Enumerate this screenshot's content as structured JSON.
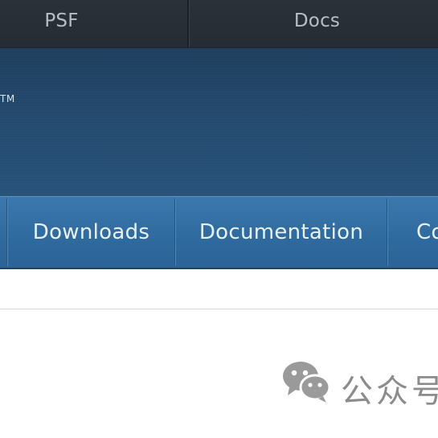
{
  "top_nav": {
    "items": [
      {
        "label": "PSF"
      },
      {
        "label": "Docs"
      }
    ]
  },
  "header": {
    "trademark": "TM"
  },
  "main_nav": {
    "items": [
      {
        "label": "Downloads"
      },
      {
        "label": "Documentation"
      },
      {
        "label": "Co"
      }
    ]
  },
  "watermark": {
    "text": "公众号",
    "icon": "wechat-icon"
  },
  "colors": {
    "top_nav_bg": "#2b3139",
    "header_bg": "#244b70",
    "main_nav_bg": "#3b78ad",
    "nav_text": "#e9f1f8",
    "page_bg": "#ffffff"
  }
}
